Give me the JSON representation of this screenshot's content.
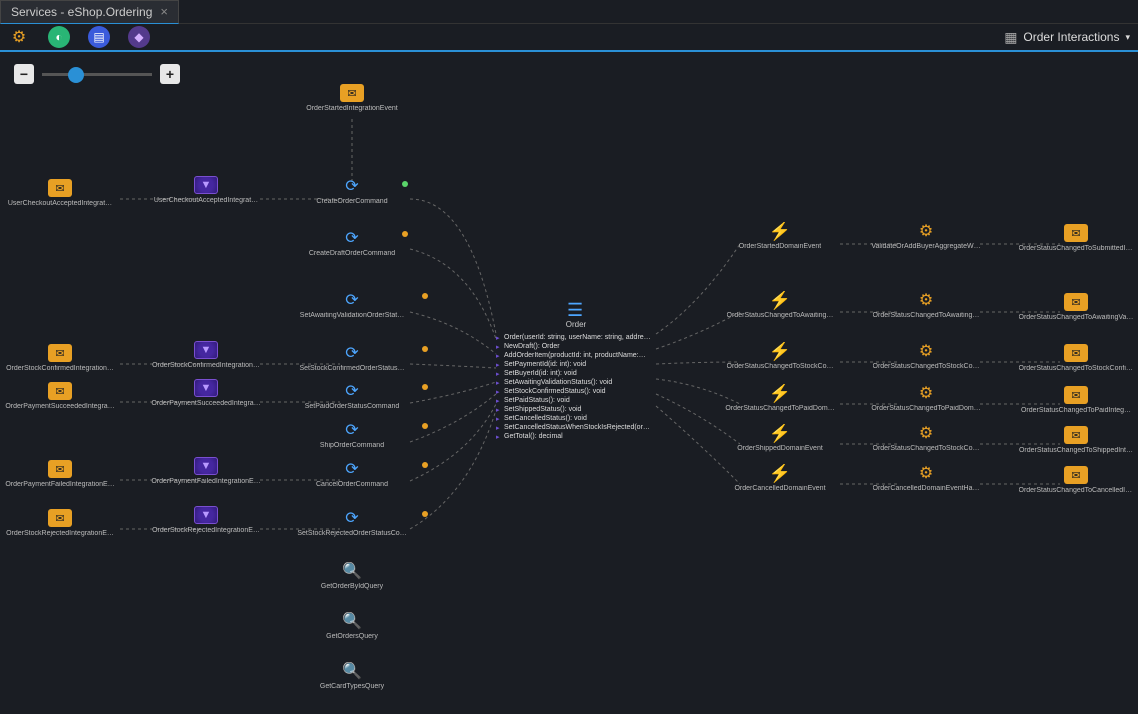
{
  "tab": {
    "title": "Services - eShop.Ordering"
  },
  "interactions_label": "Order Interactions",
  "entity": {
    "title": "Order",
    "members": [
      "Order(userId: string, userName: string, addre…",
      "NewDraft(): Order",
      "AddOrderItem(productId: int, productName:…",
      "SetPaymentId(id: int): void",
      "SetBuyerId(id: int): void",
      "SetAwaitingValidationStatus(): void",
      "SetStockConfirmedStatus(): void",
      "SetPaidStatus(): void",
      "SetShippedStatus(): void",
      "SetCancelledStatus(): void",
      "SetCancelledStatusWhenStockIsRejected(or…",
      "GetTotal(): decimal"
    ]
  },
  "nodes": {
    "topEvent": "OrderStartedIntegrationEvent",
    "leftCol1": [
      "UserCheckoutAcceptedIntegrat…",
      "OrderStockConfirmedIntegration…",
      "OrderPaymentSucceededIntegra…",
      "OrderPaymentFailedIntegrationE…",
      "OrderStockRejectedIntegrationE…"
    ],
    "leftCol2": [
      "UserCheckoutAcceptedIntegrat…",
      "OrderStockConfirmedIntegration…",
      "OrderPaymentSucceededIntegra…",
      "OrderPaymentFailedIntegrationE…",
      "OrderStockRejectedIntegrationE…"
    ],
    "commands": [
      "CreateOrderCommand",
      "CreateDraftOrderCommand",
      "SetAwaitingValidationOrderStat…",
      "SetStockConfirmedOrderStatus…",
      "SetPaidOrderStatusCommand",
      "ShipOrderCommand",
      "CancelOrderCommand",
      "SetStockRejectedOrderStatusCo…"
    ],
    "queries": [
      "GetOrderByIdQuery",
      "GetOrdersQuery",
      "GetCardTypesQuery"
    ],
    "domainEvents": [
      "OrderStartedDomainEvent",
      "OrderStatusChangedToAwaiting…",
      "OrderStatusChangedToStockCo…",
      "OrderStatusChangedToPaidDom…",
      "OrderShippedDomainEvent",
      "OrderCancelledDomainEvent"
    ],
    "handlers": [
      "ValidateOrAddBuyerAggregateW…",
      "OrderStatusChangedToAwaiting…",
      "OrderStatusChangedToStockCo…",
      "OrderStatusChangedToPaidDom…",
      "OrderStatusChangedToStockCo…",
      "OrderCancelledDomainEventHa…"
    ],
    "rightEvents": [
      "OrderStatusChangedToSubmittedIn…",
      "OrderStatusChangedToAwaitingVali…",
      "OrderStatusChangedToStockConfir…",
      "OrderStatusChangedToPaidInteg…",
      "OrderStatusChangedToShippedInt…",
      "OrderStatusChangedToCancelledIn…"
    ]
  }
}
